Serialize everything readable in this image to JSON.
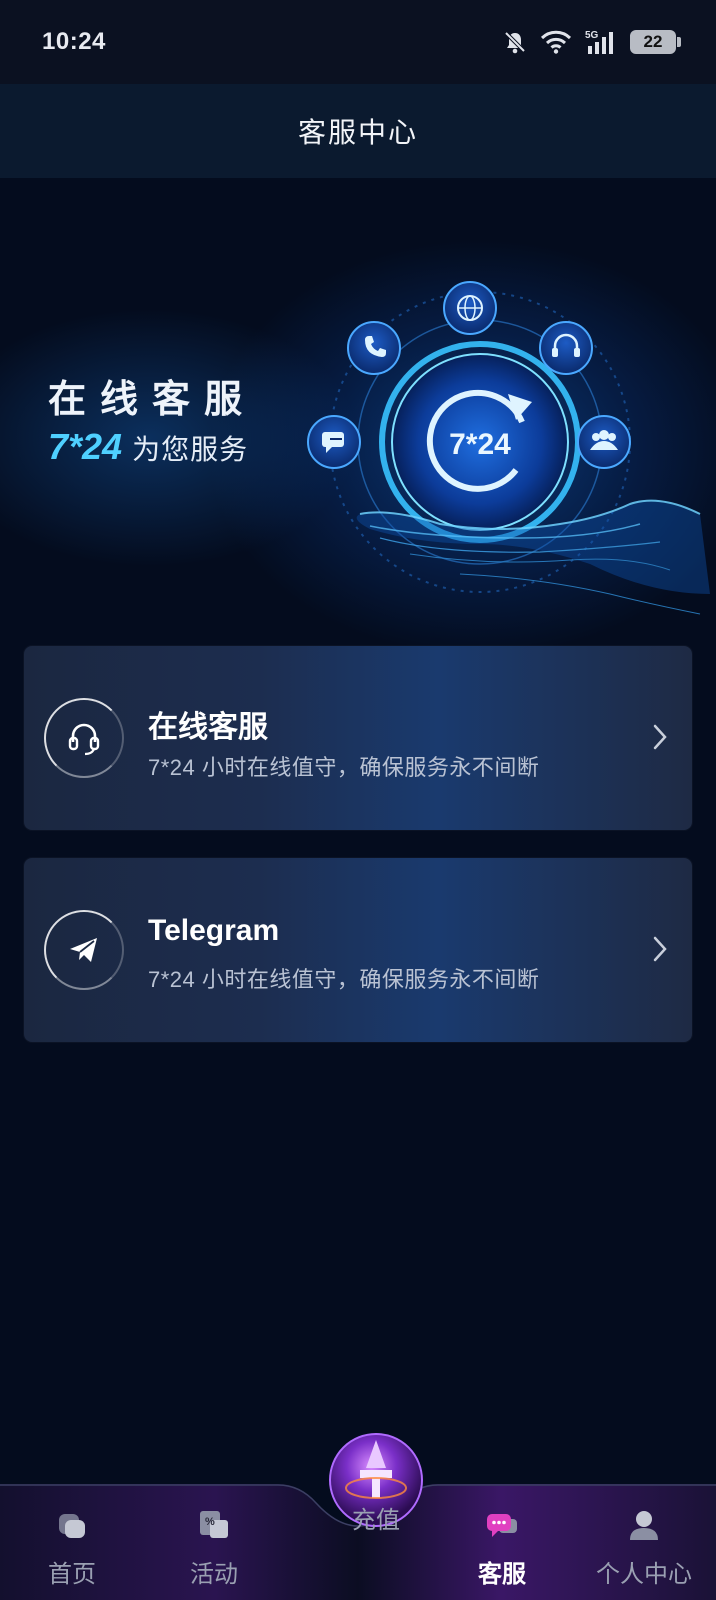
{
  "status_bar": {
    "time": "10:24",
    "network": "5G",
    "battery": "22"
  },
  "header": {
    "title": "客服中心"
  },
  "banner": {
    "title": "在线客服",
    "hours": "7*24",
    "subtitle": "为您服务",
    "badge": "7*24"
  },
  "cards": [
    {
      "title": "在线客服",
      "description": "7*24 小时在线值守，确保服务永不间断",
      "icon": "headset-icon"
    },
    {
      "title": "Telegram",
      "description": "7*24 小时在线值守，确保服务永不间断",
      "icon": "telegram-icon"
    }
  ],
  "tabbar": {
    "items": [
      {
        "label": "首页",
        "icon": "home-icon"
      },
      {
        "label": "活动",
        "icon": "activity-icon"
      },
      {
        "label": "充值",
        "icon": "recharge-icon"
      },
      {
        "label": "客服",
        "icon": "chat-icon",
        "active": true
      },
      {
        "label": "个人中心",
        "icon": "user-icon"
      }
    ]
  },
  "colors": {
    "accent": "#4fd0ff",
    "background": "#040c1e",
    "tab_active": "#e040c0"
  }
}
